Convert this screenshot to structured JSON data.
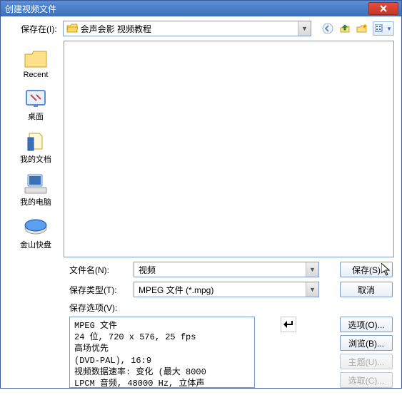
{
  "window": {
    "title": "创建视频文件"
  },
  "save_in": {
    "label": "保存在(I):",
    "folder": "会声会影  视频教程"
  },
  "places": [
    {
      "label": "Recent"
    },
    {
      "label": "桌面"
    },
    {
      "label": "我的文档"
    },
    {
      "label": "我的电脑"
    },
    {
      "label": "金山快盘"
    }
  ],
  "filename": {
    "label": "文件名(N):",
    "value": "视频"
  },
  "filetype": {
    "label": "保存类型(T):",
    "value": "MPEG 文件 (*.mpg)"
  },
  "buttons": {
    "save": "保存(S)",
    "cancel": "取消",
    "options": "选项(O)...",
    "browse": "浏览(B)...",
    "subject": "主题(U)...",
    "select": "选取(C)..."
  },
  "options_label": "保存选项(V):",
  "info": "MPEG 文件\n24 位, 720 x 576, 25 fps\n高场优先\n(DVD-PAL), 16:9\n视频数据速率: 变化 (最大  8000\nLPCM 音频, 48000 Hz, 立体声"
}
